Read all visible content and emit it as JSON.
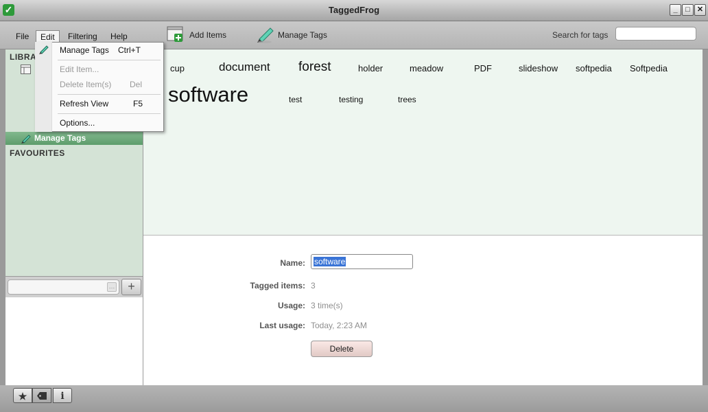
{
  "window": {
    "title": "TaggedFrog"
  },
  "menubar": {
    "file": "File",
    "edit": "Edit",
    "filtering": "Filtering",
    "help": "Help"
  },
  "toolbar": {
    "add_items": "Add Items",
    "manage_tags": "Manage Tags",
    "search_label": "Search for tags",
    "search_value": ""
  },
  "sidebar": {
    "library_header": "LIBRA",
    "manage_tags": "Manage Tags",
    "favourites_header": "FAVOURITES",
    "filter_placeholder": ""
  },
  "edit_menu": {
    "items": [
      {
        "label": "Manage Tags",
        "shortcut": "Ctrl+T",
        "enabled": true
      },
      {
        "label": "Edit Item...",
        "shortcut": "",
        "enabled": false
      },
      {
        "label": "Delete Item(s)",
        "shortcut": "Del",
        "enabled": false
      },
      {
        "label": "Refresh View",
        "shortcut": "F5",
        "enabled": true
      },
      {
        "label": "Options...",
        "shortcut": "",
        "enabled": true
      }
    ]
  },
  "tag_cloud": {
    "row1": [
      "cup",
      "document",
      "forest",
      "holder",
      "meadow",
      "PDF",
      "slideshow",
      "softpedia",
      "Softpedia"
    ],
    "row2": [
      "software",
      "test",
      "testing",
      "trees"
    ]
  },
  "details": {
    "name_label": "Name:",
    "name_value": "software",
    "tagged_items_label": "Tagged items:",
    "tagged_items_value": "3",
    "usage_label": "Usage:",
    "usage_value": "3 time(s)",
    "last_usage_label": "Last usage:",
    "last_usage_value": "Today, 2:23 AM",
    "delete_label": "Delete"
  },
  "bottom_bar": {
    "favourites_icon": "star-icon",
    "tags_icon": "tag-icon",
    "info_icon": "info-icon",
    "info_glyph": "i"
  }
}
